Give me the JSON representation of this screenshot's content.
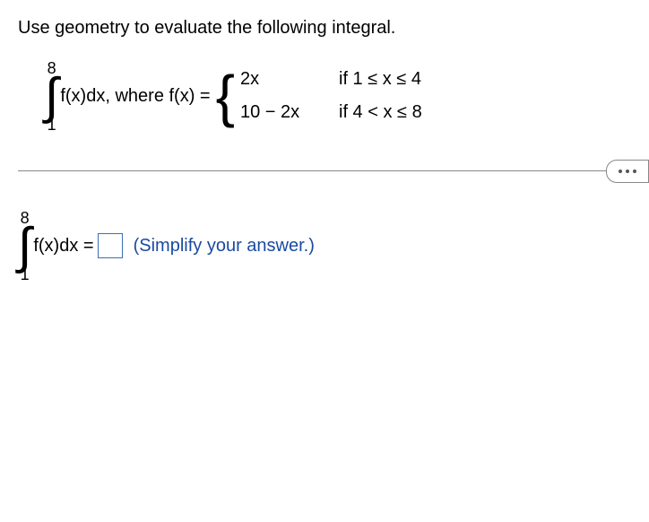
{
  "prompt": "Use geometry to evaluate the following integral.",
  "integral": {
    "upper": "8",
    "lower": "1",
    "integrand": "f(x)dx,",
    "where_label": "where f(x) ="
  },
  "cases": [
    {
      "expr": "2x",
      "cond": "if 1 ≤ x ≤ 4"
    },
    {
      "expr": "10 − 2x",
      "cond": "if 4 < x ≤ 8"
    }
  ],
  "answer": {
    "upper": "8",
    "lower": "1",
    "integrand": "f(x)dx =",
    "hint": "(Simplify your answer.)"
  }
}
